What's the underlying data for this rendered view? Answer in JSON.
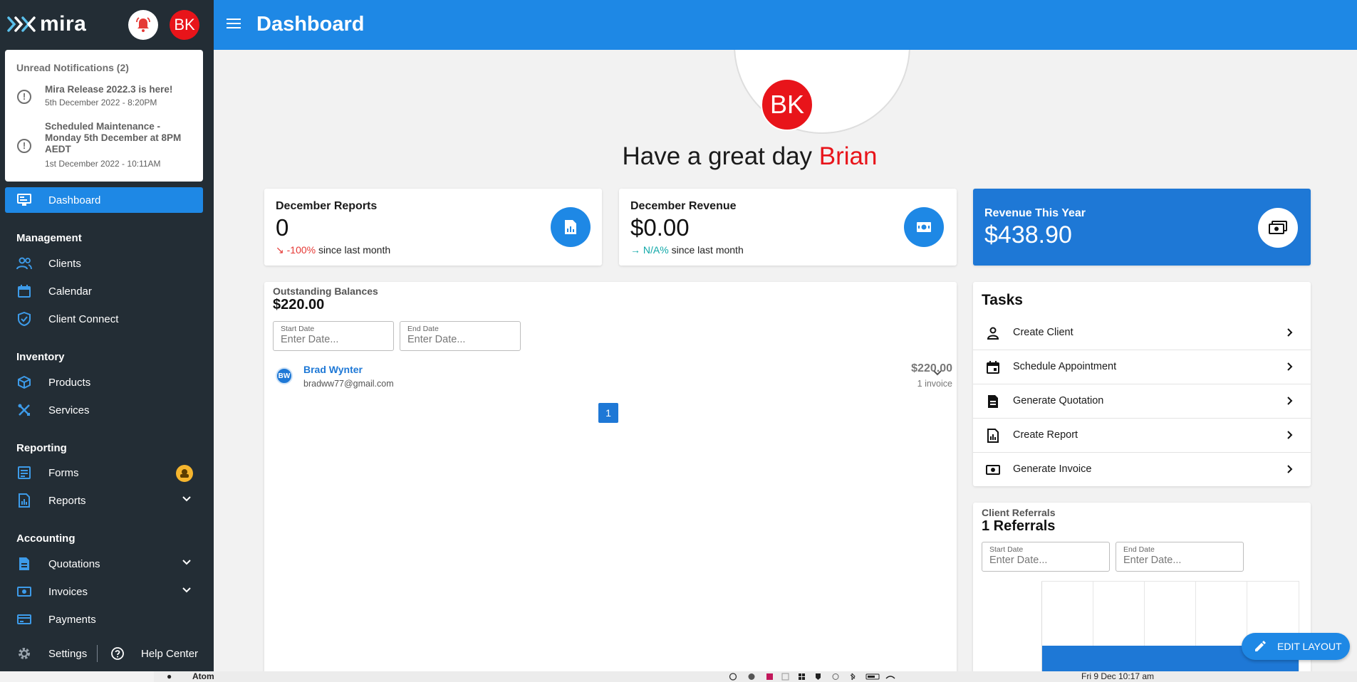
{
  "brand": {
    "name": "mira"
  },
  "header": {
    "user_initials": "BK",
    "page_title": "Dashboard"
  },
  "notifications": {
    "header": "Unread Notifications (2)",
    "items": [
      {
        "title": "Mira Release 2022.3 is here!",
        "date": "5th December 2022 - 8:20PM"
      },
      {
        "title": "Scheduled Maintenance - Monday 5th December at 8PM AEDT",
        "date": "1st December 2022 - 10:11AM"
      }
    ]
  },
  "sidebar": {
    "dashboard": "Dashboard",
    "sections": {
      "management": "Management",
      "inventory": "Inventory",
      "reporting": "Reporting",
      "accounting": "Accounting"
    },
    "items": {
      "clients": "Clients",
      "calendar": "Calendar",
      "client_connect": "Client Connect",
      "products": "Products",
      "services": "Services",
      "forms": "Forms",
      "reports": "Reports",
      "quotations": "Quotations",
      "invoices": "Invoices",
      "payments": "Payments"
    },
    "footer": {
      "settings": "Settings",
      "help": "Help Center"
    }
  },
  "hero": {
    "initials": "BK",
    "greeting": "Have a great day",
    "name": "Brian"
  },
  "stats": {
    "reports": {
      "title": "December Reports",
      "value": "0",
      "change": "-100%",
      "since": "since last month"
    },
    "revenue": {
      "title": "December Revenue",
      "value": "$0.00",
      "change": "N/A%",
      "since": "since last month"
    },
    "year": {
      "title": "Revenue This Year",
      "value": "$438.90"
    }
  },
  "outstanding": {
    "title": "Outstanding Balances",
    "amount": "$220.00",
    "start_label": "Start Date",
    "start_placeholder": "Enter Date...",
    "end_label": "End Date",
    "end_placeholder": "Enter Date...",
    "clients": [
      {
        "initials": "BW",
        "name": "Brad Wynter",
        "email": "bradww77@gmail.com",
        "amount": "$220.00",
        "invoices": "1 invoice"
      }
    ],
    "page": "1"
  },
  "tasks": {
    "title": "Tasks",
    "items": [
      {
        "label": "Create Client",
        "icon": "person-icon"
      },
      {
        "label": "Schedule Appointment",
        "icon": "calendar-icon"
      },
      {
        "label": "Generate Quotation",
        "icon": "document-icon"
      },
      {
        "label": "Create Report",
        "icon": "report-icon"
      },
      {
        "label": "Generate Invoice",
        "icon": "money-icon"
      }
    ]
  },
  "referrals": {
    "title": "Client Referrals",
    "count": "1 Referrals",
    "start_label": "Start Date",
    "start_placeholder": "Enter Date...",
    "end_label": "End Date",
    "end_placeholder": "Enter Date..."
  },
  "edit_layout": "EDIT LAYOUT",
  "menubar": {
    "app": "Atom",
    "clock": "Fri 9 Dec 10:17 am"
  },
  "colors": {
    "primary": "#1e88e5",
    "sidebar": "#232d35",
    "accent_red": "#e8141a",
    "negative": "#e53935",
    "neutral": "#10a8a8",
    "badge": "#f5b52e"
  }
}
